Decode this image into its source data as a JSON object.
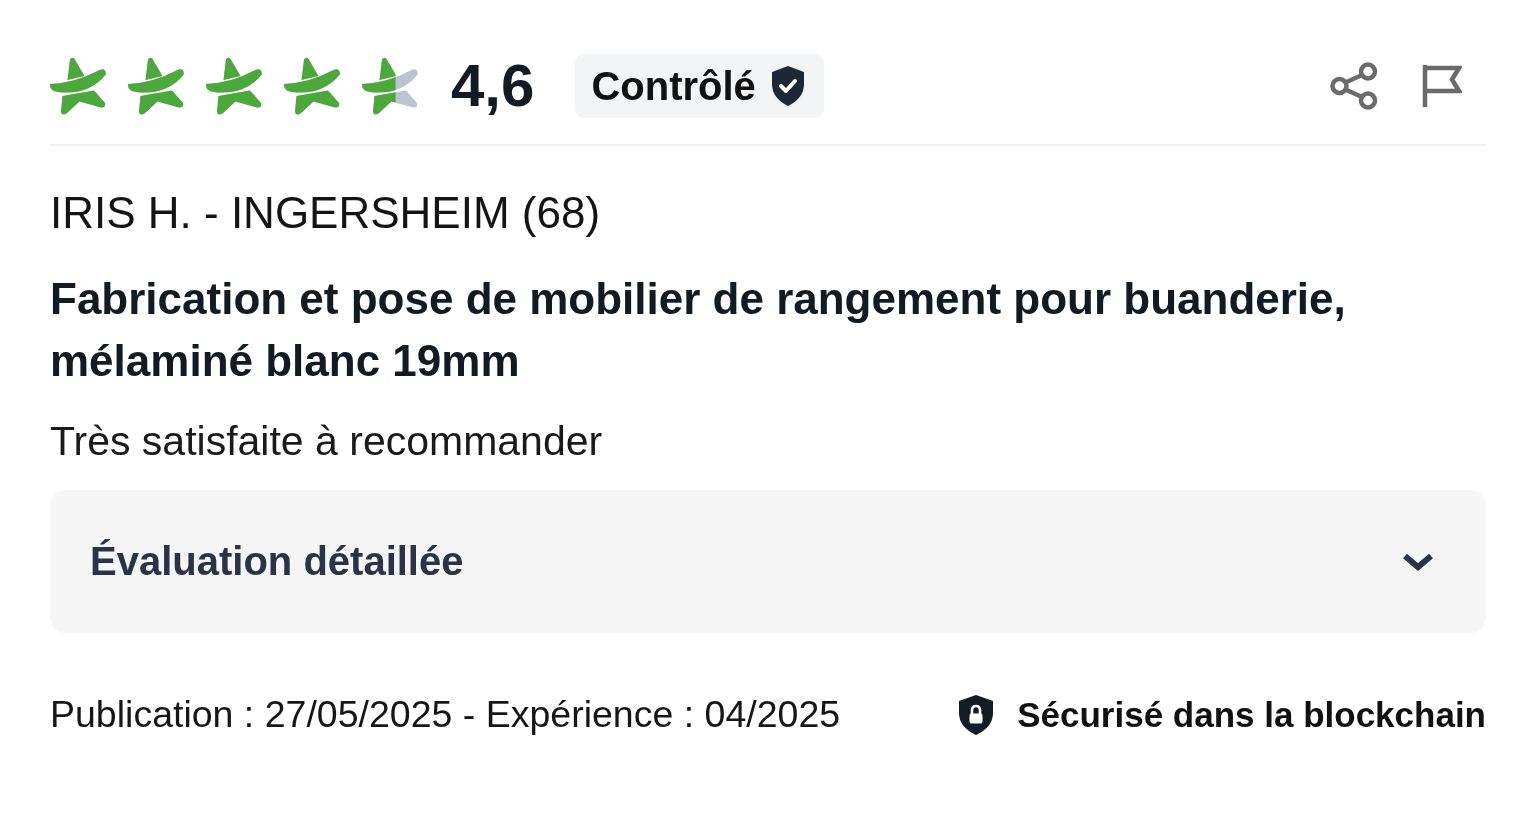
{
  "rating": {
    "stars": 4.6,
    "score": "4,6"
  },
  "badge": {
    "label": "Contrôlé"
  },
  "review": {
    "author": "IRIS H. - INGERSHEIM (68)",
    "title": "Fabrication et pose de mobilier de rangement pour buanderie, mélaminé blanc 19mm",
    "comment": "Très satisfaite à recommander"
  },
  "details": {
    "label": "Évaluation détaillée",
    "expanded": false
  },
  "footer": {
    "dates": "Publication : 27/05/2025 - Expérience : 04/2025",
    "security": "Sécurisé dans la blockchain"
  }
}
